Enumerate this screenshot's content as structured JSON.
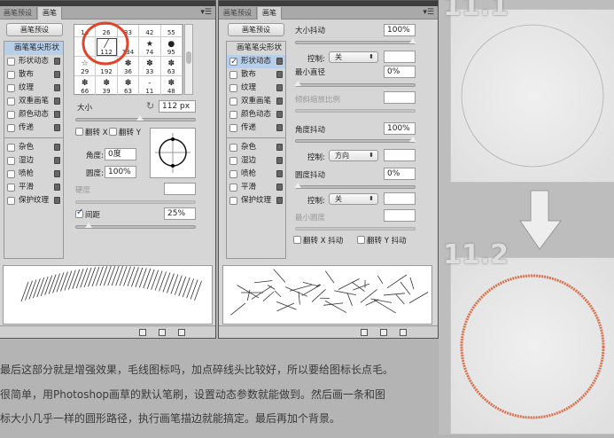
{
  "left_panel": {
    "tabs": [
      "画笔预设",
      "画笔"
    ],
    "preset_button": "画笔预设",
    "list": {
      "header": "画笔笔尖形状",
      "items": [
        "形状动态",
        "散布",
        "纹理",
        "双重画笔",
        "颜色动态",
        "传递"
      ],
      "items2": [
        "杂色",
        "湿边",
        "喷枪",
        "平滑",
        "保护纹理"
      ]
    },
    "brush_sizes": [
      "14",
      "26",
      "33",
      "42",
      "55",
      "",
      "112",
      "134",
      "74",
      "95",
      "29",
      "192",
      "36",
      "33",
      "63",
      "66",
      "39",
      "63",
      "11",
      "48"
    ],
    "selected_brush": "112",
    "size_label": "大小",
    "size_value": "112 px",
    "flip_x": "翻转 X",
    "flip_y": "翻转 Y",
    "angle_label": "角度:",
    "angle_value": "0度",
    "roundness_label": "圆度:",
    "roundness_value": "100%",
    "hardness_label": "硬度",
    "spacing_label": "间距",
    "spacing_checked": true,
    "spacing_value": "25%",
    "size_slider": 0.58,
    "spacing_slider": 0.08
  },
  "right_panel": {
    "tabs": [
      "画笔预设",
      "画笔"
    ],
    "preset_button": "画笔预设",
    "list": {
      "header": "画笔笔尖形状",
      "items": [
        "形状动态",
        "散布",
        "纹理",
        "双重画笔",
        "颜色动态",
        "传递"
      ],
      "items2": [
        "杂色",
        "湿边",
        "喷枪",
        "平滑",
        "保护纹理"
      ],
      "checked": "形状动态"
    },
    "size_jitter_label": "大小抖动",
    "size_jitter": "100%",
    "control_label": "控制:",
    "control1": "关",
    "min_diameter_label": "最小直径",
    "min_diameter": "0%",
    "tilt_scale_label": "倾斜缩放比例",
    "angle_jitter_label": "角度抖动",
    "angle_jitter": "100%",
    "control2": "方向",
    "roundness_jitter_label": "圆度抖动",
    "roundness_jitter": "0%",
    "control3": "关",
    "min_roundness_label": "最小圆度",
    "flip_x_jitter": "翻转 X 抖动",
    "flip_y_jitter": "翻转 Y 抖动"
  },
  "steps": {
    "step1": "11.1",
    "step2": "11.2"
  },
  "colors": {
    "highlight_circle": "#e0442a",
    "stroke_circle": "#d9714f"
  },
  "text": [
    "最后这部分就是增强效果，毛线图标吗，加点碎线头比较好，所以要给图标长点毛。",
    "很简单，用Photoshop画草的默认笔刷，设置动态参数就能做到。然后画一条和图",
    "标大小几乎一样的圆形路径，执行画笔描边就能搞定。最后再加个背景。"
  ]
}
